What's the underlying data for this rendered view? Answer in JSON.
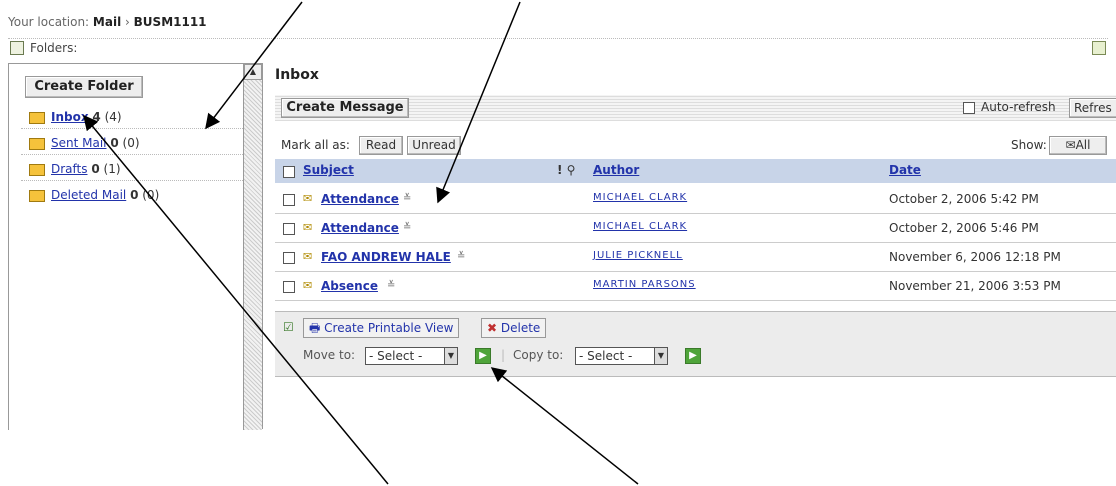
{
  "location": {
    "prefix": "Your location:",
    "mail": "Mail",
    "sep": "›",
    "course": "BUSM1111"
  },
  "folders_label": "Folders:",
  "sidebar": {
    "create_folder": "Create Folder",
    "items": [
      {
        "name": "Inbox",
        "unread": "4",
        "total": "(4)"
      },
      {
        "name": "Sent Mail",
        "unread": "0",
        "total": "(0)"
      },
      {
        "name": "Drafts",
        "unread": "0",
        "total": "(1)"
      },
      {
        "name": "Deleted Mail",
        "unread": "0",
        "total": "(0)"
      }
    ]
  },
  "main": {
    "title": "Inbox",
    "create_message": "Create Message",
    "auto_refresh": "Auto-refresh",
    "refresh": "Refres",
    "mark_all_as": "Mark all as:",
    "read": "Read",
    "unread": "Unread",
    "show": "Show:",
    "show_value": "All",
    "columns": {
      "subject": "Subject",
      "flags": "! ⚲",
      "author": "Author",
      "date": "Date"
    },
    "rows": [
      {
        "subject": "Attendance",
        "author": "MICHAEL CLARK",
        "date": "October 2, 2006 5:42 PM"
      },
      {
        "subject": "Attendance",
        "author": "MICHAEL CLARK",
        "date": "October 2, 2006 5:46 PM"
      },
      {
        "subject": "FAO ANDREW HALE",
        "author": "JULIE PICKNELL",
        "date": "November 6, 2006 12:18 PM"
      },
      {
        "subject": "Absence",
        "author": "MARTIN PARSONS",
        "date": "November 21, 2006 3:53 PM"
      }
    ],
    "printable_view": "Create Printable View",
    "delete": "Delete",
    "move_to": "Move to:",
    "copy_to": "Copy to:",
    "select_placeholder": "- Select -"
  }
}
